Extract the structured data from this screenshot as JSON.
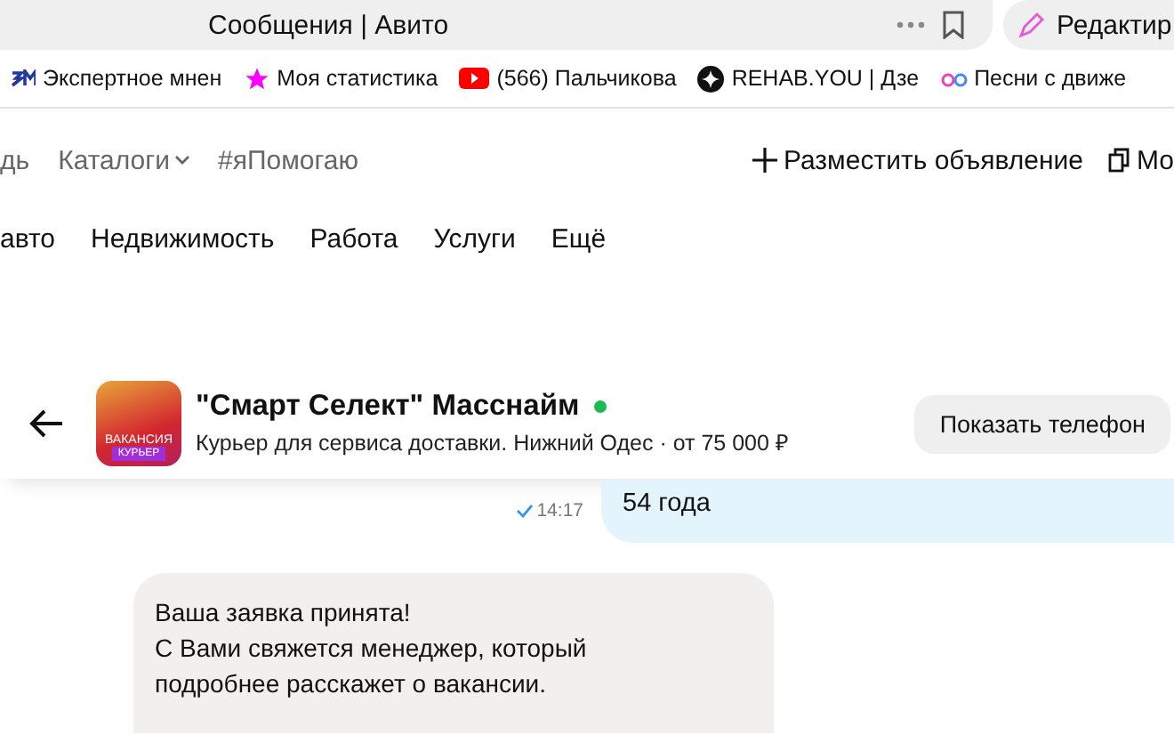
{
  "browser": {
    "tab_title": "Сообщения | Авито",
    "edit_button": "Редактир"
  },
  "bookmarks": [
    {
      "kind": "em",
      "label": "Экспертное мнен"
    },
    {
      "kind": "star",
      "label": "Моя статистика"
    },
    {
      "kind": "play",
      "label": "(566) Пальчикова"
    },
    {
      "kind": "spark",
      "label": "REHAB.YOU | Дзе"
    },
    {
      "kind": "notes",
      "label": "Песни с движе"
    }
  ],
  "nav": {
    "left": [
      {
        "label": "дь",
        "dropdown": false
      },
      {
        "label": "Каталоги",
        "dropdown": true
      },
      {
        "label": "#яПомогаю",
        "dropdown": false
      }
    ],
    "post_button": "Разместить объявление",
    "right_cut": "Мо"
  },
  "categories": [
    "авто",
    "Недвижимость",
    "Работа",
    "Услуги",
    "Ещё"
  ],
  "chat": {
    "name": "\"Смарт Селект\" Масснайм",
    "online": true,
    "subtitle": "Курьер для сервиса доставки. Нижний Одес · от 75 000 ₽",
    "thumb_tag": "КУРЬЕР",
    "thumb_caption": "ВАКАНСИЯ",
    "show_phone": "Показать телефон"
  },
  "messages": [
    {
      "kind": "out",
      "text": "54 года",
      "time": "14:17",
      "read": true
    },
    {
      "kind": "in",
      "lines": [
        "Ваша заявка принята!",
        "С Вами свяжется менеджер, который",
        "подробнее расскажет о вакансии."
      ]
    }
  ]
}
